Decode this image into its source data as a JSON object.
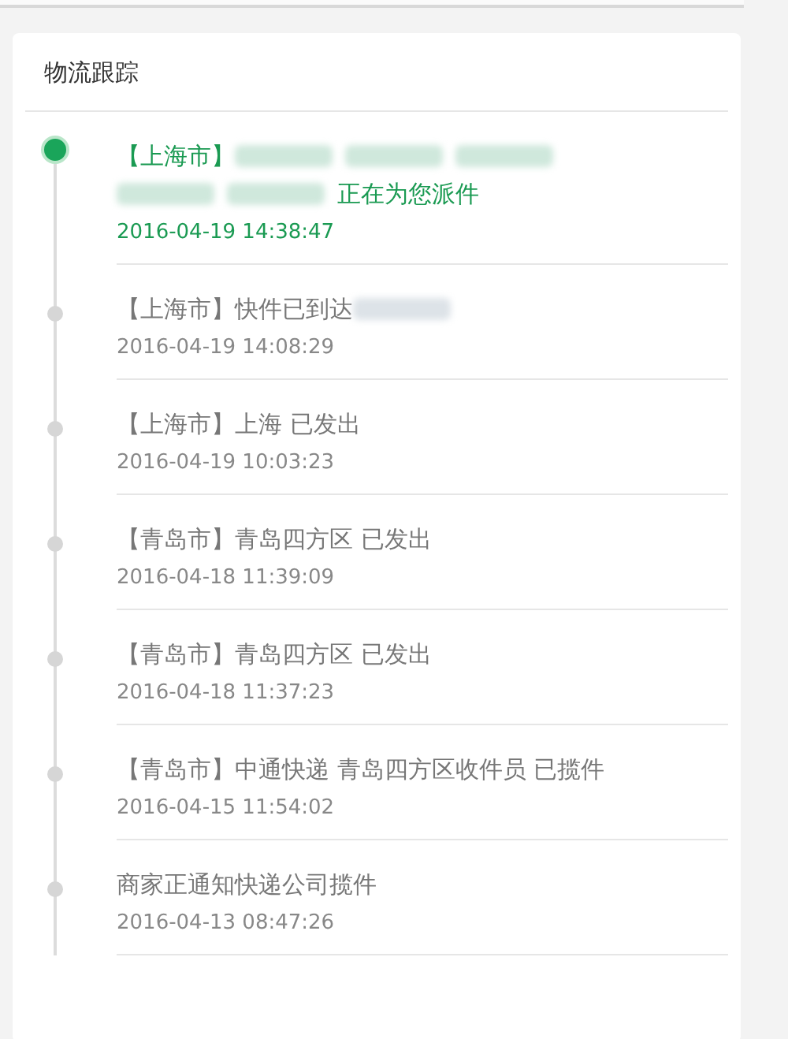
{
  "title": "物流跟踪",
  "events": [
    {
      "current": true,
      "lines": [
        {
          "segments": [
            {
              "kind": "text",
              "text": "【上海市】"
            },
            {
              "kind": "redaction"
            },
            {
              "kind": "redaction"
            },
            {
              "kind": "redaction"
            }
          ]
        },
        {
          "segments": [
            {
              "kind": "redaction"
            },
            {
              "kind": "redaction"
            },
            {
              "kind": "text",
              "text": "正在为您派件"
            }
          ]
        }
      ],
      "time": "2016-04-19 14:38:47"
    },
    {
      "current": false,
      "lines": [
        {
          "segments": [
            {
              "kind": "text",
              "text": "【上海市】快件已到达"
            },
            {
              "kind": "redaction"
            }
          ]
        }
      ],
      "time": "2016-04-19 14:08:29"
    },
    {
      "current": false,
      "lines": [
        {
          "segments": [
            {
              "kind": "text",
              "text": "【上海市】上海 已发出"
            }
          ]
        }
      ],
      "time": "2016-04-19 10:03:23"
    },
    {
      "current": false,
      "lines": [
        {
          "segments": [
            {
              "kind": "text",
              "text": "【青岛市】青岛四方区 已发出"
            }
          ]
        }
      ],
      "time": "2016-04-18 11:39:09"
    },
    {
      "current": false,
      "lines": [
        {
          "segments": [
            {
              "kind": "text",
              "text": "【青岛市】青岛四方区 已发出"
            }
          ]
        }
      ],
      "time": "2016-04-18 11:37:23"
    },
    {
      "current": false,
      "lines": [
        {
          "segments": [
            {
              "kind": "text",
              "text": "【青岛市】中通快递 青岛四方区收件员 已揽件"
            }
          ]
        }
      ],
      "time": "2016-04-15 11:54:02"
    },
    {
      "current": false,
      "lines": [
        {
          "segments": [
            {
              "kind": "text",
              "text": "商家正通知快递公司揽件"
            }
          ]
        }
      ],
      "time": "2016-04-13 08:47:26"
    }
  ]
}
